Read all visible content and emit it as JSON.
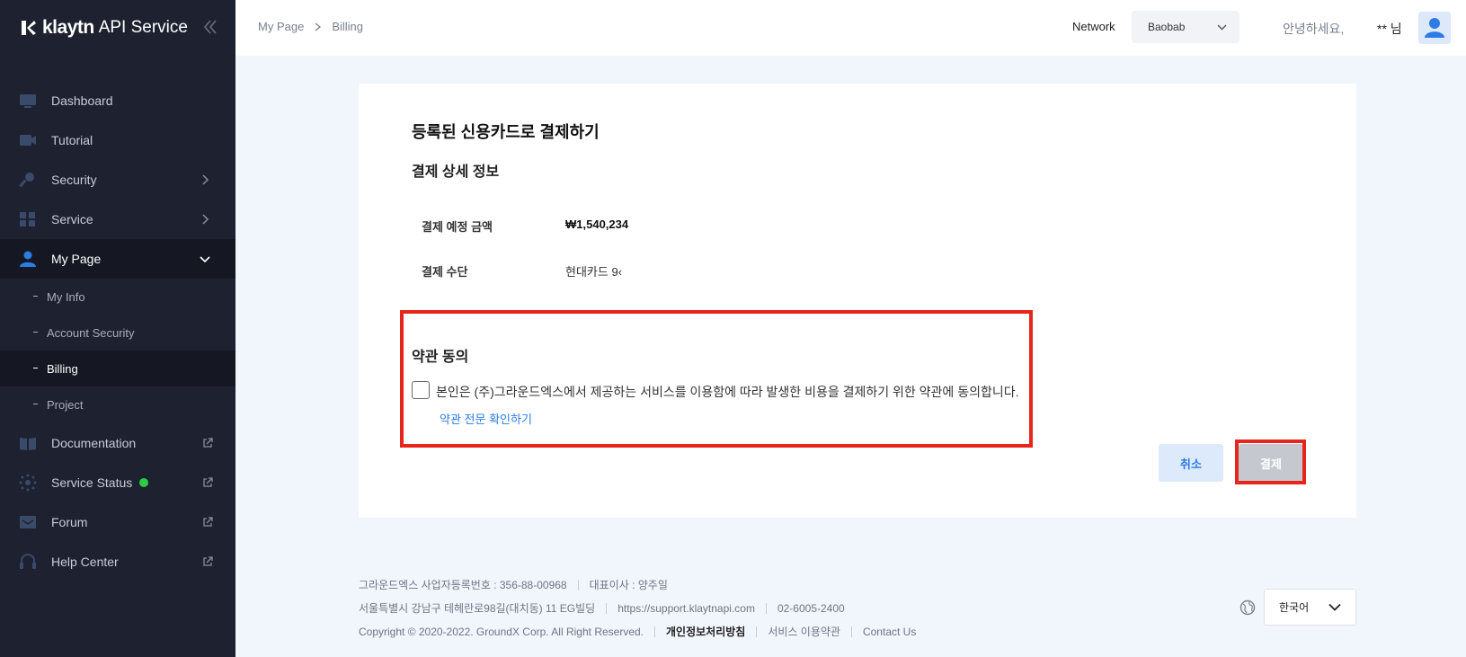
{
  "sidebar": {
    "brand": {
      "name": "klaytn",
      "suffix": "API Service"
    },
    "items": [
      {
        "label": "Dashboard",
        "icon": "dashboard-icon"
      },
      {
        "label": "Tutorial",
        "icon": "video-icon"
      },
      {
        "label": "Security",
        "icon": "key-icon"
      },
      {
        "label": "Service",
        "icon": "grid-icon"
      },
      {
        "label": "My Page",
        "icon": "user-icon"
      },
      {
        "label": "Documentation",
        "icon": "book-icon"
      },
      {
        "label": "Service Status",
        "icon": "status-icon"
      },
      {
        "label": "Forum",
        "icon": "chat-icon"
      },
      {
        "label": "Help Center",
        "icon": "headset-icon"
      }
    ],
    "mypage_sub": [
      {
        "label": "My Info"
      },
      {
        "label": "Account Security"
      },
      {
        "label": "Billing"
      },
      {
        "label": "Project"
      }
    ],
    "status_color": "#2ecc40"
  },
  "header": {
    "breadcrumb": [
      "My Page",
      "Billing"
    ],
    "network_label": "Network",
    "network_value": "Baobab",
    "greeting": "안녕하세요,",
    "user_name": "** 님"
  },
  "payment": {
    "title": "등록된 신용카드로 결제하기",
    "detail_title": "결제 상세 정보",
    "amount_label": "결제 예정 금액",
    "amount_value": "₩1,540,234",
    "method_label": "결제 수단",
    "method_value": "현대카드 9‹",
    "terms_title": "약관 동의",
    "terms_text": "본인은 (주)그라운드엑스에서 제공하는 서비스를 이용함에 따라 발생한 비용을 결제하기 위한 약관에 동의합니다.",
    "terms_link": "약관 전문 확인하기",
    "cancel_label": "취소",
    "pay_label": "결제"
  },
  "footer": {
    "line1": [
      "그라운드엑스 사업자등록번호 : 356-88-00968",
      "대표이사 : 양주일"
    ],
    "line2": [
      "서울특별시 강남구 테헤란로98길(대치동) 11 EG빌딩",
      "https://support.klaytnapi.com",
      "02-6005-2400"
    ],
    "copyright": "Copyright © 2020-2022. GroundX Corp. All Right Reserved.",
    "privacy": "개인정보처리방침",
    "terms": "서비스 이용약관",
    "contact": "Contact Us",
    "language": "한국어"
  },
  "colors": {
    "accent": "#2d7be5",
    "highlight": "#e6251c",
    "sidebar_bg": "#1e2230"
  }
}
